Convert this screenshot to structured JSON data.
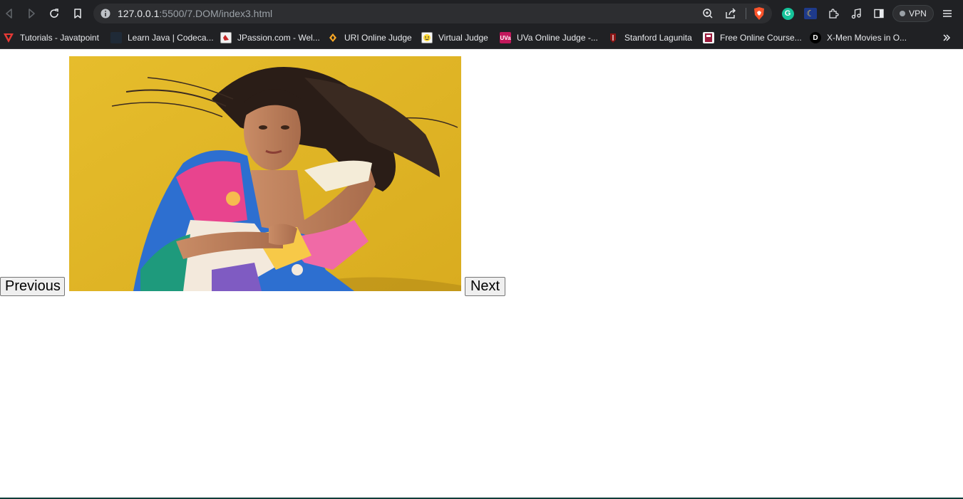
{
  "browser": {
    "url_host": "127.0.0.1",
    "url_rest": ":5500/7.DOM/index3.html",
    "vpn_label": "VPN",
    "bookmarks": [
      {
        "label": "Tutorials - Javatpoint",
        "icon": "javatpoint-icon"
      },
      {
        "label": "Learn Java | Codeca...",
        "icon": "codecademy-icon"
      },
      {
        "label": "JPassion.com - Wel...",
        "icon": "jpassion-icon"
      },
      {
        "label": "URI Online Judge",
        "icon": "uri-icon"
      },
      {
        "label": "Virtual Judge",
        "icon": "vjudge-icon"
      },
      {
        "label": "UVa Online Judge -...",
        "icon": "uva-icon",
        "icon_text": "UVa"
      },
      {
        "label": "Stanford Lagunita",
        "icon": "stanford-icon"
      },
      {
        "label": "Free Online Course...",
        "icon": "edx-icon"
      },
      {
        "label": "X-Men Movies in O...",
        "icon": "xmen-icon",
        "icon_text": "D"
      }
    ]
  },
  "page": {
    "previous_label": "Previous",
    "next_label": "Next"
  },
  "colors": {
    "chrome_bg": "#202124",
    "photo_bg": "#e2b827",
    "button_bg": "#efefef"
  }
}
